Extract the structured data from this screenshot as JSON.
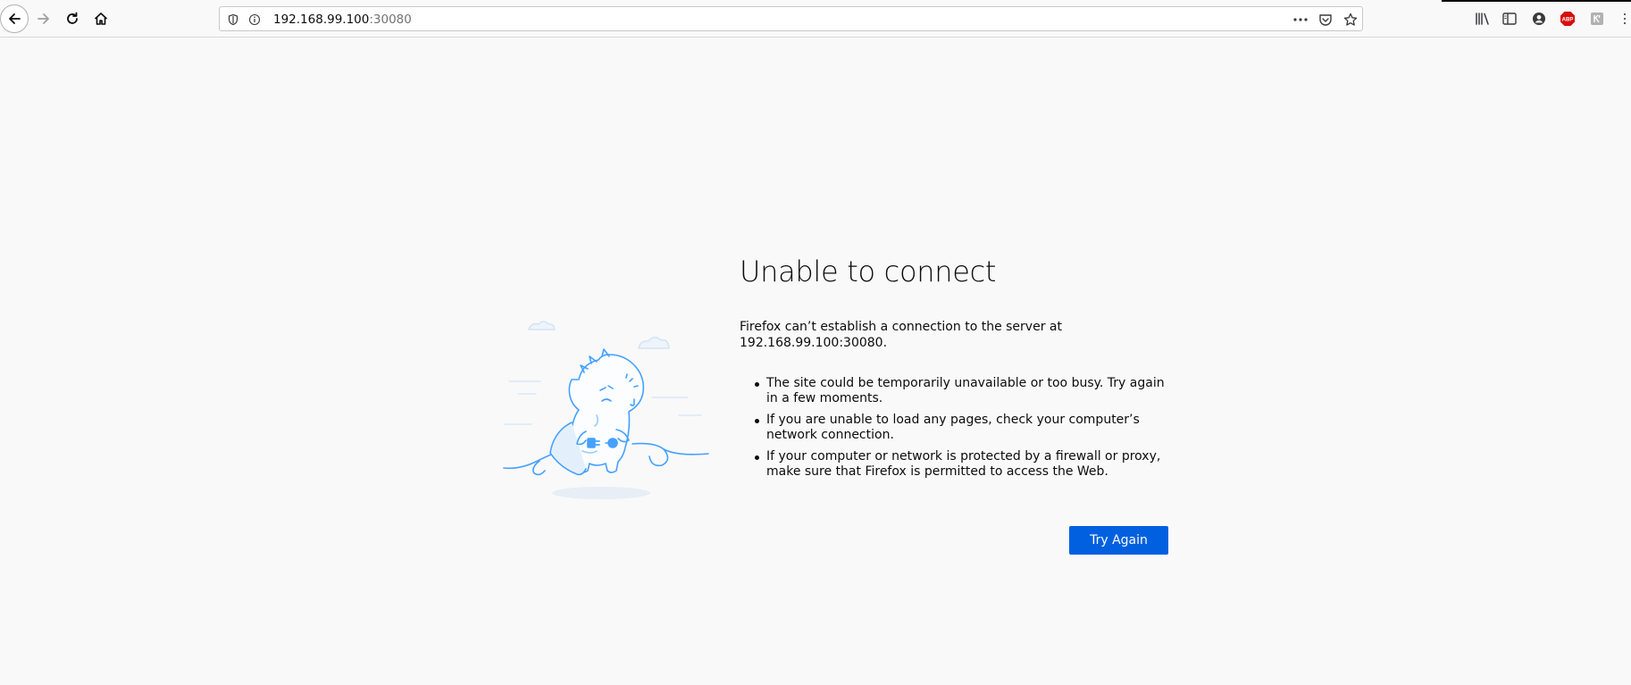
{
  "browser": {
    "url_host": "192.168.99.100",
    "url_port": ":30080"
  },
  "error": {
    "title": "Unable to connect",
    "description": "Firefox can’t establish a connection to the server at 192.168.99.100:30080.",
    "bullets": [
      "The site could be temporarily unavailable or too busy. Try again in a few moments.",
      "If you are unable to load any pages, check your computer’s network connection.",
      "If your computer or network is protected by a firewall or proxy, make sure that Firefox is permitted to access the Web."
    ],
    "try_again_label": "Try Again"
  },
  "icons": {
    "adblock_label": "ABP"
  },
  "colors": {
    "accent": "#0060df",
    "illustration": "#45a1ff"
  }
}
